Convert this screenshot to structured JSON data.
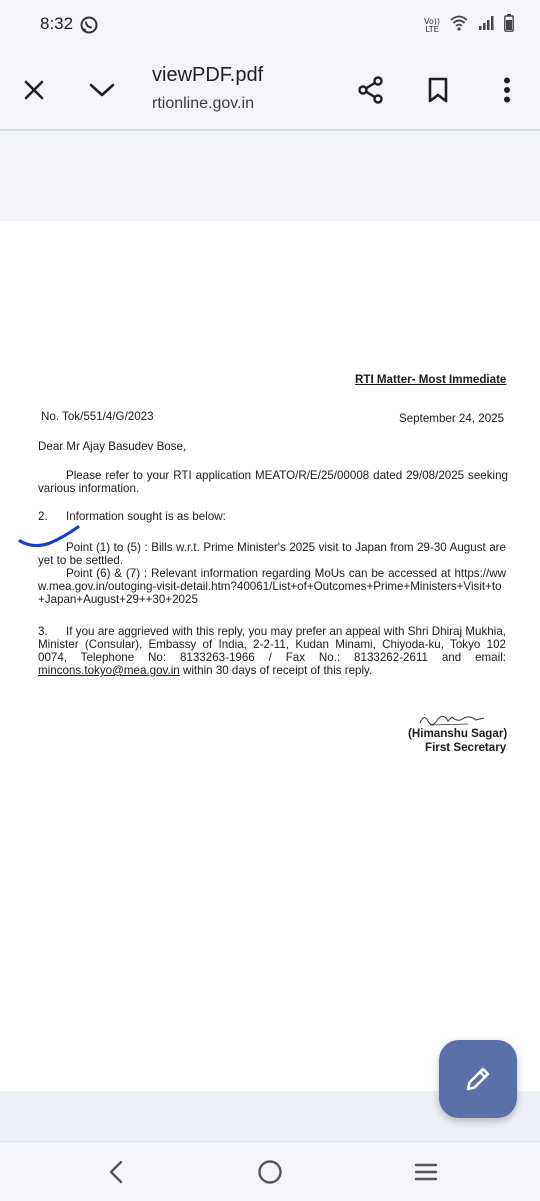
{
  "status_bar": {
    "time": "8:32",
    "network_label_top": "Vo))",
    "network_label_bottom": "LTE",
    "icons": [
      "whatsapp-icon",
      "volte-icon",
      "wifi-icon",
      "signal-icon",
      "battery-icon"
    ]
  },
  "app_bar": {
    "title": "viewPDF.pdf",
    "url": "rtionline.gov.in",
    "icons": [
      "close-icon",
      "chevron-down-icon",
      "share-icon",
      "bookmark-icon",
      "more-vert-icon"
    ]
  },
  "document": {
    "header": "RTI Matter- Most Immediate",
    "ref_no": "No. Tok/551/4/G/2023",
    "date": "September 24, 2025",
    "salutation": "Dear Mr Ajay Basudev Bose,",
    "para1": "Please refer to your RTI application MEATO/R/E/25/00008 dated 29/08/2025 seeking various information.",
    "para2_num": "2.",
    "para2_text": "Information sought is as below:",
    "point1": "Point (1) to (5) :  Bills w.r.t. Prime Minister's 2025 visit to Japan from 29-30 August are yet to be settled.",
    "point2_lead": "Point (6) & (7) :  Relevant information regarding MoUs can be accessed at ",
    "point2_url": "https://www.mea.gov.in/outoging-visit-detail.htm?40061/List+of+Outcomes+Prime+Ministers+Visit+to+Japan+August+29++30+2025",
    "para3_num": "3.",
    "para3_text": "If you are aggrieved with this reply, you may prefer an appeal with Shri Dhiraj Mukhia, Minister (Consular), Embassy of India, 2-2-11, Kudan Minami, Chiyoda-ku, Tokyo 102 0074, Telephone No: 8133263-1966 / Fax No.: 8133262-2611 and email: ",
    "para3_email": "mincons.tokyo@mea.gov.in",
    "para3_tail": " within 30 days of receipt of this reply.",
    "signatory_name": "(Himanshu Sagar)",
    "signatory_title": "First Secretary"
  },
  "fab": {
    "icon": "edit-pencil-icon"
  },
  "nav_bar": {
    "icons": [
      "back-icon",
      "home-icon",
      "recents-icon"
    ]
  },
  "colors": {
    "fab": "#5b6fa8",
    "bars": "#f4f5fb",
    "viewer_bg": "#eef0f7",
    "pen_mark": "#1a3fc4"
  }
}
